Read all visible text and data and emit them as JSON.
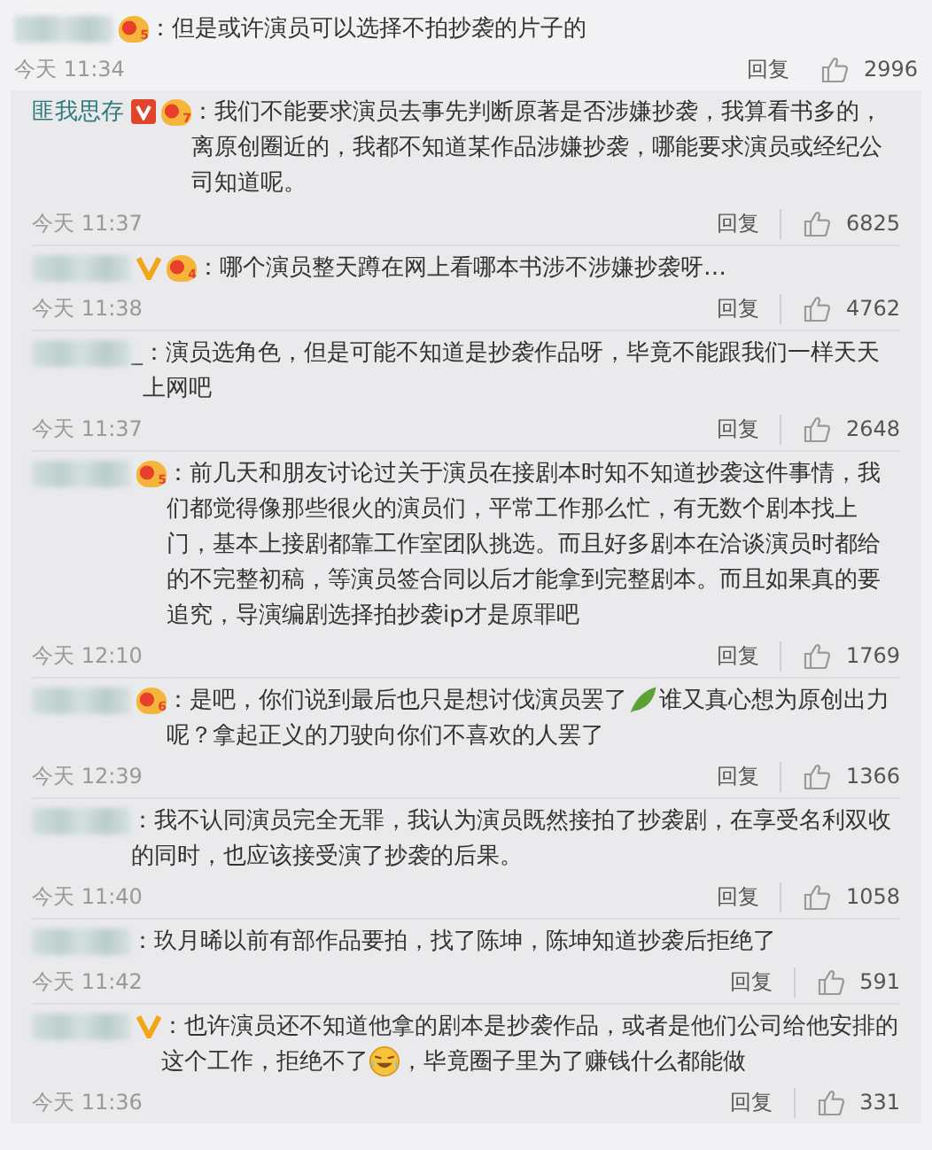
{
  "comment": {
    "badges": [
      {
        "kind": "level",
        "text": "5"
      }
    ],
    "segments": [
      {
        "kind": "text",
        "text": "：但是或许演员可以选择不拍抄袭的片子的"
      }
    ],
    "time": "今天 11:34",
    "reply": "回复",
    "likes": "2996"
  },
  "replies": [
    {
      "name": "匪我思存",
      "badges": [
        {
          "kind": "red-v"
        },
        {
          "kind": "level",
          "text": "7"
        }
      ],
      "segments": [
        {
          "kind": "text",
          "text": "：我们不能要求演员去事先判断原著是否涉嫌抄袭，我算看书多的，离原创圈近的，我都不知道某作品涉嫌抄袭，哪能要求演员或经纪公司知道呢。"
        }
      ],
      "time": "今天 11:37",
      "reply": "回复",
      "likes": "6825"
    },
    {
      "badges": [
        {
          "kind": "orange-v"
        },
        {
          "kind": "level",
          "text": "4"
        }
      ],
      "segments": [
        {
          "kind": "text",
          "text": "：哪个演员整天蹲在网上看哪本书涉不涉嫌抄袭呀…"
        }
      ],
      "time": "今天 11:38",
      "reply": "回复",
      "likes": "4762"
    },
    {
      "name_suffix": "_",
      "segments": [
        {
          "kind": "text",
          "text": "：演员选角色，但是可能不知道是抄袭作品呀，毕竟不能跟我们一样天天上网吧"
        }
      ],
      "time": "今天 11:37",
      "reply": "回复",
      "likes": "2648"
    },
    {
      "badges": [
        {
          "kind": "level",
          "text": "5"
        }
      ],
      "segments": [
        {
          "kind": "text",
          "text": "：前几天和朋友讨论过关于演员在接剧本时知不知道抄袭这件事情，我们都觉得像那些很火的演员们，平常工作那么忙，有无数个剧本找上门，基本上接剧都靠工作室团队挑选。而且好多剧本在洽谈演员时都给的不完整初稿，等演员签合同以后才能拿到完整剧本。而且如果真的要追究，导演编剧选择拍抄袭ip才是原罪吧"
        }
      ],
      "time": "今天 12:10",
      "reply": "回复",
      "likes": "1769"
    },
    {
      "badges": [
        {
          "kind": "level",
          "text": "6"
        }
      ],
      "segments": [
        {
          "kind": "text",
          "text": "：是吧，你们说到最后也只是想讨伐演员罢了"
        },
        {
          "kind": "leaf"
        },
        {
          "kind": "text",
          "text": "谁又真心想为原创出力呢？拿起正义的刀驶向你们不喜欢的人罢了"
        }
      ],
      "time": "今天 12:39",
      "reply": "回复",
      "likes": "1366"
    },
    {
      "segments": [
        {
          "kind": "text",
          "text": "：我不认同演员完全无罪，我认为演员既然接拍了抄袭剧，在享受名利双收的同时，也应该接受演了抄袭的后果。"
        }
      ],
      "time": "今天 11:40",
      "reply": "回复",
      "likes": "1058"
    },
    {
      "segments": [
        {
          "kind": "text",
          "text": "：玖月晞以前有部作品要拍，找了陈坤，陈坤知道抄袭后拒绝了"
        }
      ],
      "time": "今天 11:42",
      "reply": "回复",
      "likes": "591"
    },
    {
      "badges": [
        {
          "kind": "orange-v"
        }
      ],
      "segments": [
        {
          "kind": "text",
          "text": "：也许演员还不知道他拿的剧本是抄袭作品，或者是他们公司给他安排的这个工作，拒绝不了"
        },
        {
          "kind": "laughing-face"
        },
        {
          "kind": "text",
          "text": "，毕竟圈子里为了赚钱什么都能做"
        }
      ],
      "time": "今天 11:36",
      "reply": "回复",
      "likes": "331"
    }
  ]
}
